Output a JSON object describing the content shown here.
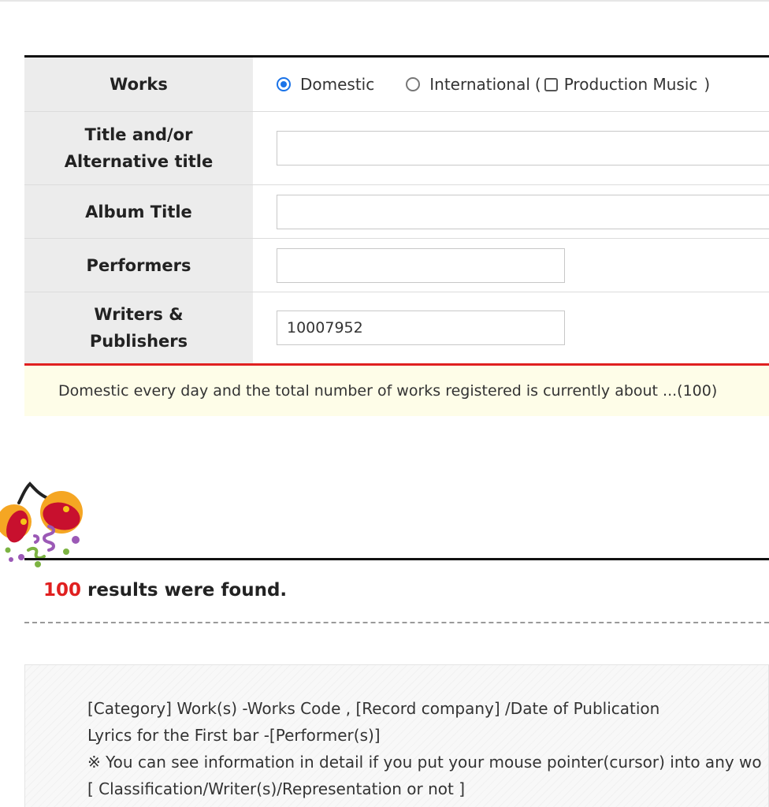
{
  "form": {
    "works": {
      "label": "Works",
      "options": [
        {
          "label": "Domestic",
          "selected": true
        },
        {
          "label": "International",
          "selected": false
        }
      ],
      "paren_open": "(",
      "production_music_label": "Production Music",
      "production_music_checked": false,
      "paren_close": ")"
    },
    "title": {
      "label_line1": "Title and/or",
      "label_line2": "Alternative title",
      "value": ""
    },
    "album": {
      "label": "Album Title",
      "value": ""
    },
    "performers": {
      "label": "Performers",
      "value": ""
    },
    "writers": {
      "label_line1": "Writers &",
      "label_line2": "Publishers",
      "value": "10007952"
    }
  },
  "notice": "Domestic every day and the total number of works registered is currently about ...(100)",
  "results": {
    "count": "100",
    "text": "results were found."
  },
  "legend": {
    "line1": "[Category] Work(s) -Works Code , [Record company] /Date of Publication",
    "line2": "Lyrics for the First bar -[Performer(s)]",
    "line3": "※ You can see information in detail if you put your mouse pointer(cursor) into any wo",
    "line4": "[ Classification/Writer(s)/Representation or not ]"
  },
  "colors": {
    "accent": "#1a73e8",
    "highlight": "#e02020",
    "notice_bg": "#fefde8"
  }
}
